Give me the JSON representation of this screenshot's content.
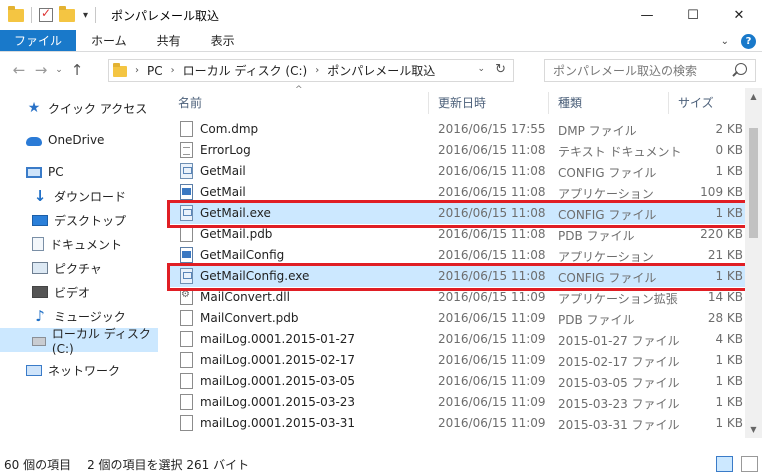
{
  "window": {
    "title": "ポンパレメール取込"
  },
  "ribbon": {
    "tabs": [
      "ファイル",
      "ホーム",
      "共有",
      "表示"
    ]
  },
  "address": {
    "crumbs": [
      "PC",
      "ローカル ディスク (C:)",
      "ポンパレメール取込"
    ]
  },
  "search": {
    "placeholder": "ポンパレメール取込の検索"
  },
  "nav": {
    "items": [
      {
        "label": "クイック アクセス",
        "icon": "star-icon"
      },
      {
        "label": "OneDrive",
        "icon": "cloud-icon"
      },
      {
        "label": "PC",
        "icon": "pc-icon"
      },
      {
        "label": "ダウンロード",
        "icon": "download-icon"
      },
      {
        "label": "デスクトップ",
        "icon": "desktop-icon"
      },
      {
        "label": "ドキュメント",
        "icon": "document-icon"
      },
      {
        "label": "ピクチャ",
        "icon": "picture-icon"
      },
      {
        "label": "ビデオ",
        "icon": "video-icon"
      },
      {
        "label": "ミュージック",
        "icon": "music-icon"
      },
      {
        "label": "ローカル ディスク (C:)",
        "icon": "drive-icon"
      },
      {
        "label": "ネットワーク",
        "icon": "network-icon"
      }
    ]
  },
  "columns": {
    "name": "名前",
    "date": "更新日時",
    "type": "種類",
    "size": "サイズ"
  },
  "files": [
    {
      "name": "Com.dmp",
      "date": "2016/06/15 17:55",
      "type": "DMP ファイル",
      "size": "2 KB",
      "icon": "file-icon"
    },
    {
      "name": "ErrorLog",
      "date": "2016/06/15 11:08",
      "type": "テキスト ドキュメント",
      "size": "0 KB",
      "icon": "log-icon"
    },
    {
      "name": "GetMail",
      "date": "2016/06/15 11:08",
      "type": "CONFIG ファイル",
      "size": "1 KB",
      "icon": "config-icon"
    },
    {
      "name": "GetMail",
      "date": "2016/06/15 11:08",
      "type": "アプリケーション",
      "size": "109 KB",
      "icon": "app-icon"
    },
    {
      "name": "GetMail.exe",
      "date": "2016/06/15 11:08",
      "type": "CONFIG ファイル",
      "size": "1 KB",
      "icon": "config-icon",
      "selected": true
    },
    {
      "name": "GetMail.pdb",
      "date": "2016/06/15 11:08",
      "type": "PDB ファイル",
      "size": "220 KB",
      "icon": "file-icon"
    },
    {
      "name": "GetMailConfig",
      "date": "2016/06/15 11:08",
      "type": "アプリケーション",
      "size": "21 KB",
      "icon": "app-icon"
    },
    {
      "name": "GetMailConfig.exe",
      "date": "2016/06/15 11:08",
      "type": "CONFIG ファイル",
      "size": "1 KB",
      "icon": "config-icon",
      "selected": true
    },
    {
      "name": "MailConvert.dll",
      "date": "2016/06/15 11:09",
      "type": "アプリケーション拡張",
      "size": "14 KB",
      "icon": "dll-icon"
    },
    {
      "name": "MailConvert.pdb",
      "date": "2016/06/15 11:09",
      "type": "PDB ファイル",
      "size": "28 KB",
      "icon": "file-icon"
    },
    {
      "name": "mailLog.0001.2015-01-27",
      "date": "2016/06/15 11:09",
      "type": "2015-01-27 ファイル",
      "size": "4 KB",
      "icon": "file-icon"
    },
    {
      "name": "mailLog.0001.2015-02-17",
      "date": "2016/06/15 11:09",
      "type": "2015-02-17 ファイル",
      "size": "1 KB",
      "icon": "file-icon"
    },
    {
      "name": "mailLog.0001.2015-03-05",
      "date": "2016/06/15 11:09",
      "type": "2015-03-05 ファイル",
      "size": "1 KB",
      "icon": "file-icon"
    },
    {
      "name": "mailLog.0001.2015-03-23",
      "date": "2016/06/15 11:09",
      "type": "2015-03-23 ファイル",
      "size": "1 KB",
      "icon": "file-icon"
    },
    {
      "name": "mailLog.0001.2015-03-31",
      "date": "2016/06/15 11:09",
      "type": "2015-03-31 ファイル",
      "size": "1 KB",
      "icon": "file-icon"
    }
  ],
  "status": {
    "count": "60 個の項目",
    "selection": "2 個の項目を選択  261 バイト"
  },
  "colors": {
    "accent": "#1979ca",
    "selection": "#cce8ff",
    "highlight_box": "#e01e24"
  }
}
